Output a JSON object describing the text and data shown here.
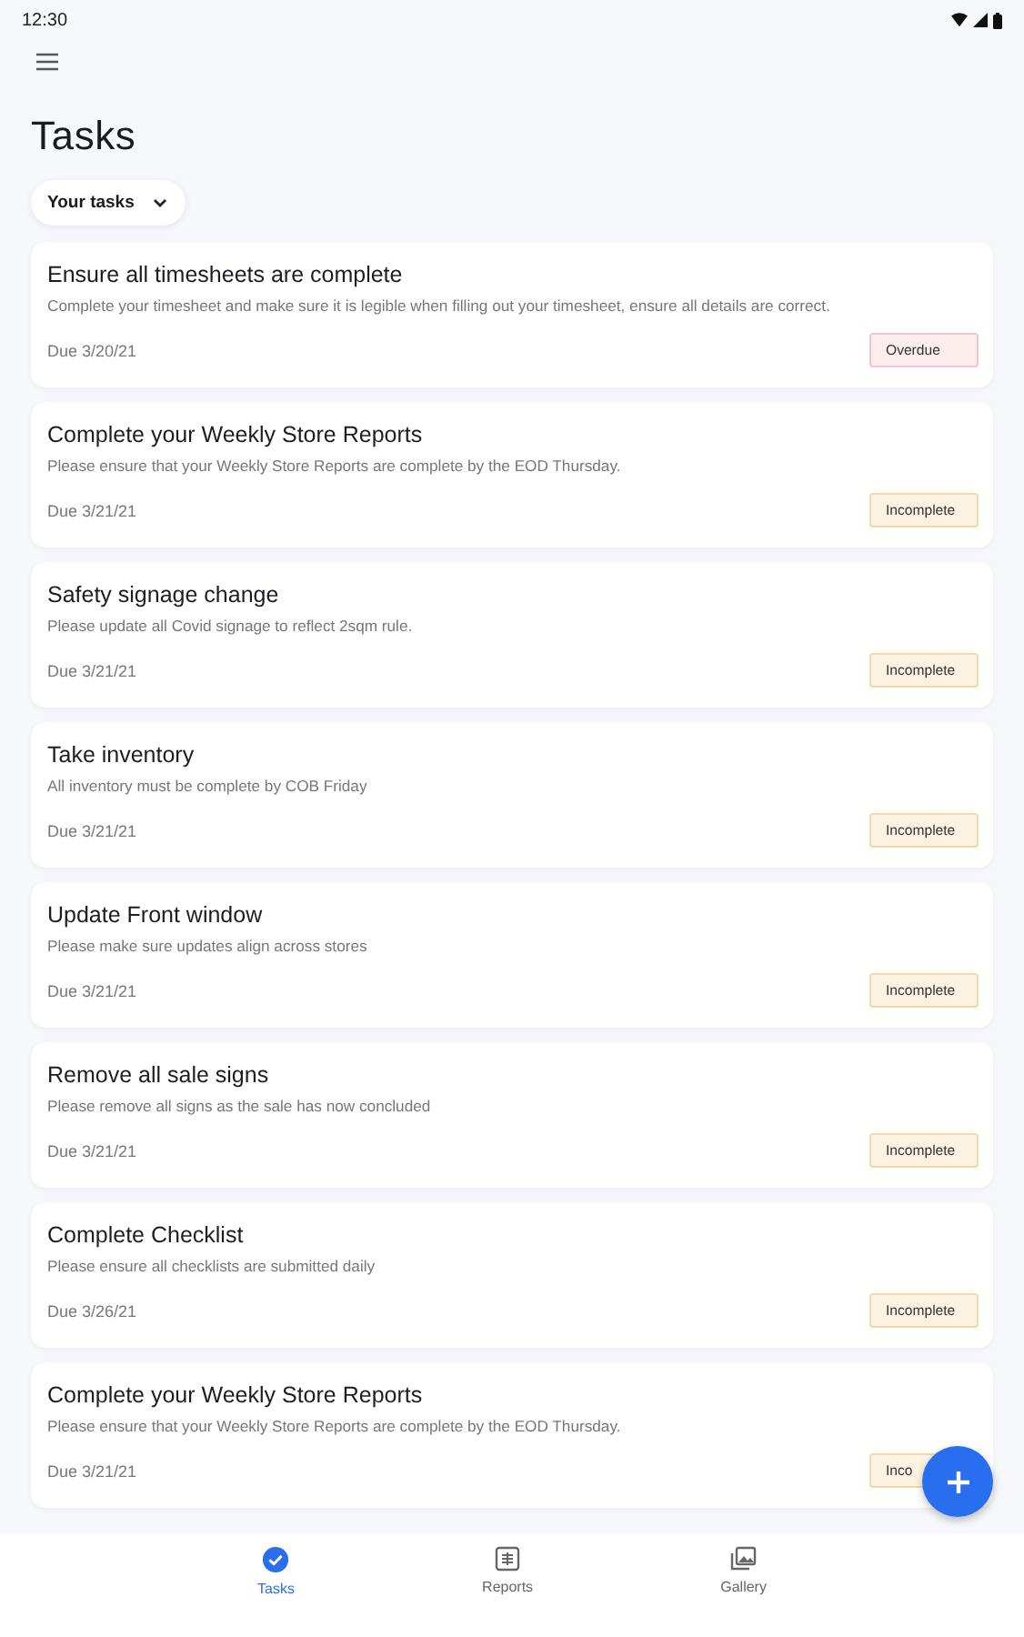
{
  "status_bar": {
    "time": "12:30"
  },
  "title": "Tasks",
  "filter": {
    "label": "Your tasks"
  },
  "tasks": [
    {
      "title": "Ensure all timesheets are complete",
      "description": "Complete your timesheet and make sure it is legible when filling out your timesheet, ensure all details are correct.",
      "due": "Due 3/20/21",
      "kind": "overdue",
      "badge": "Overdue"
    },
    {
      "title": "Complete your Weekly Store Reports",
      "description": "Please ensure that your Weekly Store Reports are complete by the EOD Thursday.",
      "due": "Due 3/21/21",
      "kind": "incomplete",
      "badge": "Incomplete"
    },
    {
      "title": "Safety signage change",
      "description": "Please update all Covid signage to reflect 2sqm rule.",
      "due": "Due 3/21/21",
      "kind": "incomplete",
      "badge": "Incomplete"
    },
    {
      "title": "Take inventory",
      "description": "All inventory must be complete by COB Friday",
      "due": "Due 3/21/21",
      "kind": "incomplete",
      "badge": "Incomplete"
    },
    {
      "title": "Update Front window",
      "description": "Please make sure updates align across stores",
      "due": "Due 3/21/21",
      "kind": "incomplete",
      "badge": "Incomplete"
    },
    {
      "title": "Remove all sale signs",
      "description": "Please remove all signs as the sale has now concluded",
      "due": "Due 3/21/21",
      "kind": "incomplete",
      "badge": "Incomplete"
    },
    {
      "title": "Complete Checklist",
      "description": "Please ensure all checklists are submitted daily",
      "due": "Due 3/26/21",
      "kind": "incomplete",
      "badge": "Incomplete"
    },
    {
      "title": "Complete your Weekly Store Reports",
      "description": "Please ensure that your Weekly Store Reports are complete by the EOD Thursday.",
      "due": "Due 3/21/21",
      "kind": "incomplete",
      "badge": "Inco"
    }
  ],
  "bottom_nav": [
    {
      "kind": "tasks",
      "label": "Tasks",
      "selected": true
    },
    {
      "kind": "reports",
      "label": "Reports",
      "selected": false
    },
    {
      "kind": "gallery",
      "label": "Gallery",
      "selected": false
    }
  ]
}
